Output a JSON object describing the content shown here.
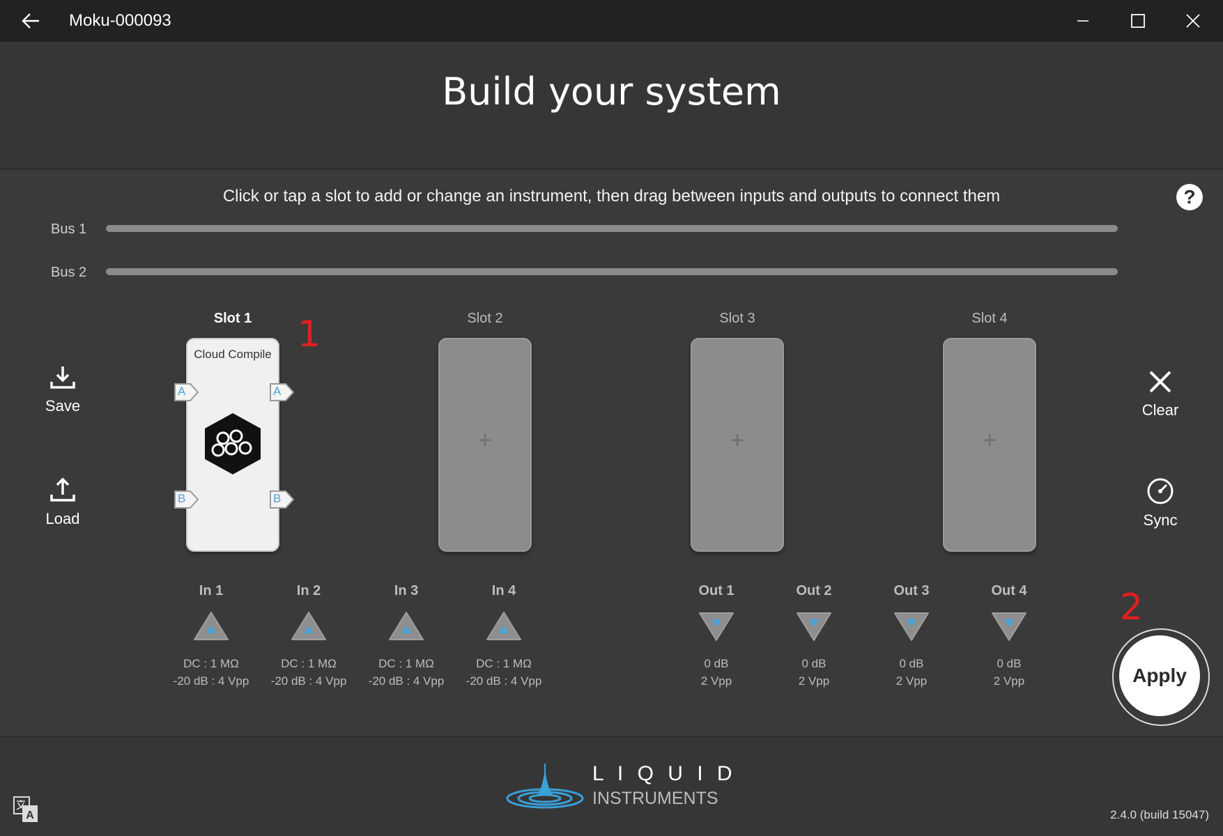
{
  "window": {
    "title": "Moku-000093"
  },
  "header": {
    "title": "Build your system"
  },
  "instructions": "Click or tap a slot to add or change an instrument, then drag between inputs and outputs to connect them",
  "help_label": "?",
  "buses": [
    {
      "label": "Bus 1"
    },
    {
      "label": "Bus 2"
    }
  ],
  "slots": [
    {
      "label": "Slot 1",
      "instrument": "Cloud Compile",
      "ports": {
        "in_a": "A",
        "in_b": "B",
        "out_a": "A",
        "out_b": "B"
      }
    },
    {
      "label": "Slot 2",
      "empty_symbol": "+"
    },
    {
      "label": "Slot 3",
      "empty_symbol": "+"
    },
    {
      "label": "Slot 4",
      "empty_symbol": "+"
    }
  ],
  "left_actions": {
    "save": "Save",
    "load": "Load"
  },
  "right_actions": {
    "clear": "Clear",
    "sync": "Sync",
    "apply": "Apply"
  },
  "inputs": [
    {
      "label": "In 1",
      "line1": "DC : 1 MΩ",
      "line2": "-20 dB : 4 Vpp"
    },
    {
      "label": "In 2",
      "line1": "DC : 1 MΩ",
      "line2": "-20 dB : 4 Vpp"
    },
    {
      "label": "In 3",
      "line1": "DC : 1 MΩ",
      "line2": "-20 dB : 4 Vpp"
    },
    {
      "label": "In 4",
      "line1": "DC : 1 MΩ",
      "line2": "-20 dB : 4 Vpp"
    }
  ],
  "outputs": [
    {
      "label": "Out 1",
      "line1": "0 dB",
      "line2": "2 Vpp"
    },
    {
      "label": "Out 2",
      "line1": "0 dB",
      "line2": "2 Vpp"
    },
    {
      "label": "Out 3",
      "line1": "0 dB",
      "line2": "2 Vpp"
    },
    {
      "label": "Out 4",
      "line1": "0 dB",
      "line2": "2 Vpp"
    }
  ],
  "annotations": {
    "marker1": "1",
    "marker2": "2"
  },
  "footer": {
    "logo_top": "L I Q U I D",
    "logo_bottom": "INSTRUMENTS",
    "version": "2.4.0 (build 15047)"
  },
  "colors": {
    "accent_port": "#4aa3d9",
    "annotation": "#e02020",
    "bus": "#8a8a8a"
  }
}
